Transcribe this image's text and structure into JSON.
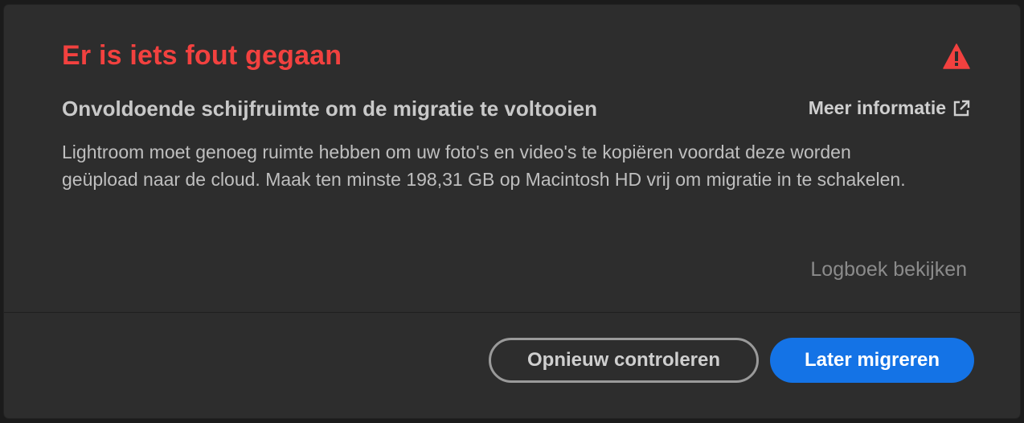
{
  "dialog": {
    "title": "Er is iets fout gegaan",
    "subtitle": "Onvoldoende schijfruimte om de migratie te voltooien",
    "more_info_label": "Meer informatie",
    "body": "Lightroom moet genoeg ruimte hebben om uw foto's en video's te kopiëren voordat deze worden geüpload naar de cloud. Maak ten minste 198,31 GB op Macintosh HD vrij om migratie in te schakelen.",
    "log_link": "Logboek bekijken",
    "buttons": {
      "secondary_label": "Opnieuw controleren",
      "primary_label": "Later migreren"
    }
  },
  "icons": {
    "warning": "warning-triangle-icon",
    "external": "external-link-icon"
  },
  "colors": {
    "title_red": "#f2413f",
    "primary_blue": "#1473e6",
    "dialog_bg": "#2d2d2d"
  }
}
